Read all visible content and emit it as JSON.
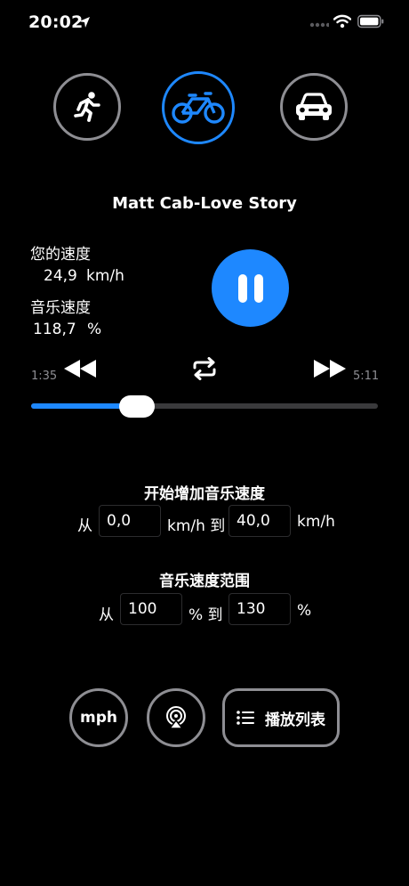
{
  "status_bar": {
    "time": "20:02"
  },
  "modes": [
    {
      "name": "walk",
      "icon": "running-person-icon",
      "active": false
    },
    {
      "name": "bike",
      "icon": "bicycle-icon",
      "active": true
    },
    {
      "name": "car",
      "icon": "car-icon",
      "active": false
    }
  ],
  "player": {
    "song_title": "Matt Cab-Love Story",
    "your_speed_label": "您的速度",
    "your_speed_value": "24,9",
    "your_speed_unit": "km/h",
    "music_speed_label": "音乐速度",
    "music_speed_value": "118,7",
    "music_speed_unit": "%",
    "elapsed": "1:35",
    "duration": "5:11",
    "progress_fraction": 0.305
  },
  "speed_range": {
    "title": "开始增加音乐速度",
    "from_label": "从",
    "from_value": "0,0",
    "unit_to": "km/h 到",
    "to_value": "40,0",
    "unit": "km/h"
  },
  "music_range": {
    "title": "音乐速度范围",
    "from_label": "从",
    "from_value": "100",
    "unit_to": "% 到",
    "to_value": "130",
    "unit": "%"
  },
  "bottom": {
    "mph_label": "mph",
    "playlist_label": "播放列表"
  },
  "colors": {
    "accent": "#1e88ff",
    "border_gray": "#8e8e93",
    "background": "#000000"
  }
}
